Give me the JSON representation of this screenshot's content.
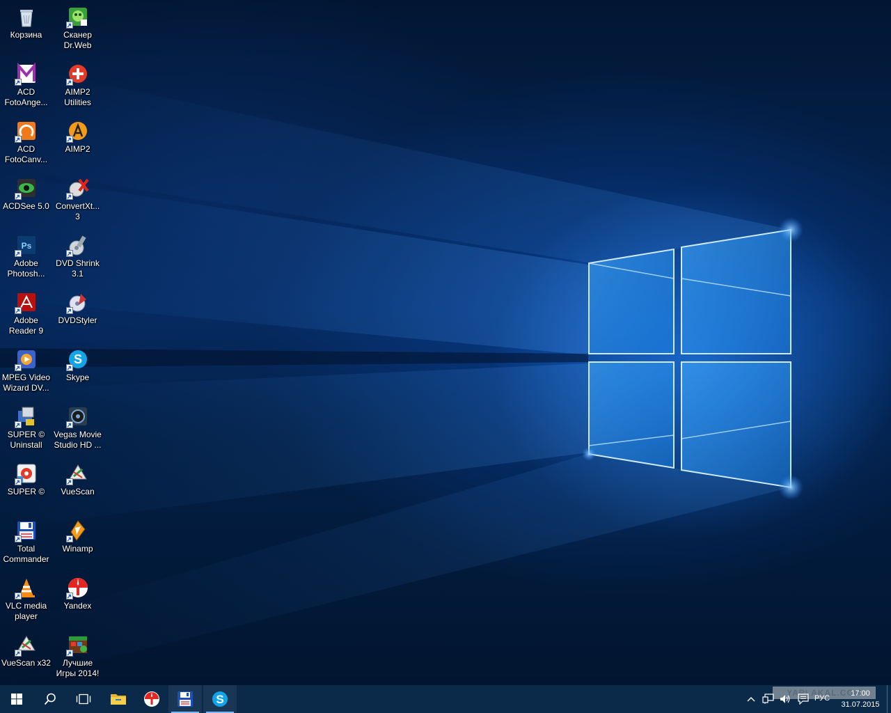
{
  "desktop": {
    "icons": [
      {
        "label": "Корзина",
        "icon": "recycle-bin-icon",
        "shortcut": false
      },
      {
        "label": "Сканер\nDr.Web",
        "icon": "drweb-scanner-icon",
        "shortcut": true
      },
      {
        "label": "ACD\nFotoAnge...",
        "icon": "acd-fotoangelo-icon",
        "shortcut": true
      },
      {
        "label": "AIMP2\nUtilities",
        "icon": "aimp2-utilities-icon",
        "shortcut": true
      },
      {
        "label": "ACD\nFotoCanv...",
        "icon": "acd-fotocanvas-icon",
        "shortcut": true
      },
      {
        "label": "AIMP2",
        "icon": "aimp2-icon",
        "shortcut": true
      },
      {
        "label": "ACDSee 5.0",
        "icon": "acdsee-icon",
        "shortcut": true
      },
      {
        "label": "ConvertXt...\n3",
        "icon": "convertxtodvd-icon",
        "shortcut": true
      },
      {
        "label": "Adobe\nPhotosh...",
        "icon": "photoshop-icon",
        "shortcut": true
      },
      {
        "label": "DVD Shrink\n3.1",
        "icon": "dvd-shrink-icon",
        "shortcut": true
      },
      {
        "label": "Adobe\nReader 9",
        "icon": "adobe-reader-icon",
        "shortcut": true
      },
      {
        "label": "DVDStyler",
        "icon": "dvdstyler-icon",
        "shortcut": true
      },
      {
        "label": "MPEG Video\nWizard DV...",
        "icon": "mpeg-video-wizard-icon",
        "shortcut": true
      },
      {
        "label": "Skype",
        "icon": "skype-icon",
        "shortcut": true
      },
      {
        "label": "SUPER ©\nUninstall",
        "icon": "super-uninstall-icon",
        "shortcut": true
      },
      {
        "label": "Vegas Movie\nStudio HD ...",
        "icon": "vegas-movie-studio-icon",
        "shortcut": true
      },
      {
        "label": "SUPER ©",
        "icon": "super-icon",
        "shortcut": true
      },
      {
        "label": "VueScan",
        "icon": "vuescan-icon",
        "shortcut": true
      },
      {
        "label": "Total\nCommander",
        "icon": "total-commander-icon",
        "shortcut": true
      },
      {
        "label": "Winamp",
        "icon": "winamp-icon",
        "shortcut": true
      },
      {
        "label": "VLC media\nplayer",
        "icon": "vlc-icon",
        "shortcut": true
      },
      {
        "label": "Yandex",
        "icon": "yandex-browser-icon",
        "shortcut": true
      },
      {
        "label": "VueScan x32",
        "icon": "vuescan-x32-icon",
        "shortcut": true
      },
      {
        "label": "Лучшие\nИгры 2014!",
        "icon": "best-games-icon",
        "shortcut": true
      }
    ]
  },
  "taskbar": {
    "buttons": [
      {
        "name": "start-button",
        "icon": "windows-logo-icon",
        "active": false
      },
      {
        "name": "search-button",
        "icon": "search-icon",
        "active": false
      },
      {
        "name": "task-view-button",
        "icon": "task-view-icon",
        "active": false
      },
      {
        "name": "file-explorer-button",
        "icon": "folder-icon",
        "active": false
      },
      {
        "name": "yandex-taskbar-button",
        "icon": "yandex-browser-icon",
        "active": false
      },
      {
        "name": "total-commander-taskbar-button",
        "icon": "floppy-disk-icon",
        "active": true
      },
      {
        "name": "skype-taskbar-button",
        "icon": "skype-icon",
        "active": true
      }
    ],
    "tray": {
      "icons": [
        "chevron-up-icon",
        "network-icon",
        "volume-icon",
        "action-center-icon"
      ],
      "language": "РУС",
      "time": "17:00",
      "date": "31.07.2015",
      "watermark": "YAPLAKAL.COM"
    }
  },
  "colors": {
    "taskbar": "#0b2a4a",
    "accent": "#7ab8f5",
    "wallpaper_glow": "#2a8cff"
  }
}
